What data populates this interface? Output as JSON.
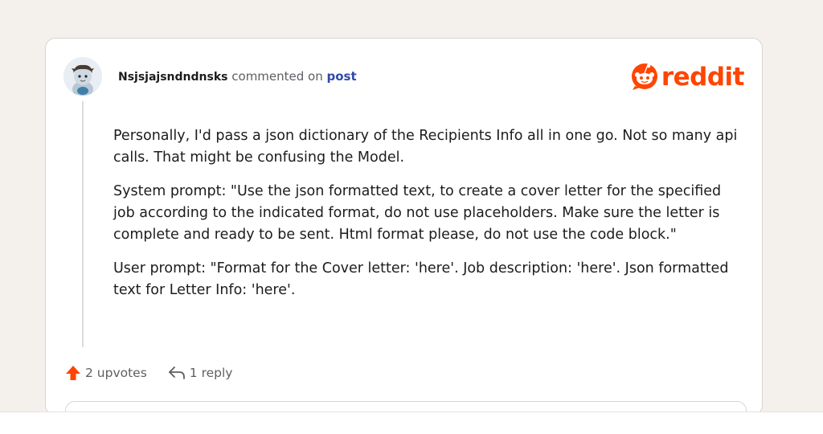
{
  "comment": {
    "username": "Nsjsjajsndndnsks",
    "action_text": "commented on",
    "post_link_label": "post",
    "paragraphs": [
      "Personally, I'd pass a json dictionary of the Recipients Info all in one go. Not so many api calls. That might be confusing the Model.",
      "System prompt: \"Use the json formatted text, to create a cover letter for the specified job according to the indicated format, do not use placeholders. Make sure the letter is complete and ready to be sent. Html format please, do not use the code block.\"",
      "User prompt: \"Format for the Cover letter: 'here'. Job description: 'here'. Json formatted text for Letter Info: 'here'."
    ],
    "upvotes_label": "2 upvotes",
    "reply_label": "1 reply"
  },
  "brand": {
    "name": "reddit",
    "logo_icon": "reddit-snoo-icon",
    "accent_color": "#ff4500"
  },
  "icons": {
    "upvote": "upvote-arrow-icon",
    "reply": "reply-arrow-icon"
  },
  "colors": {
    "background": "#f4f1ec",
    "card": "#ffffff",
    "link": "#2f4aa8",
    "upvote": "#ff4500"
  }
}
